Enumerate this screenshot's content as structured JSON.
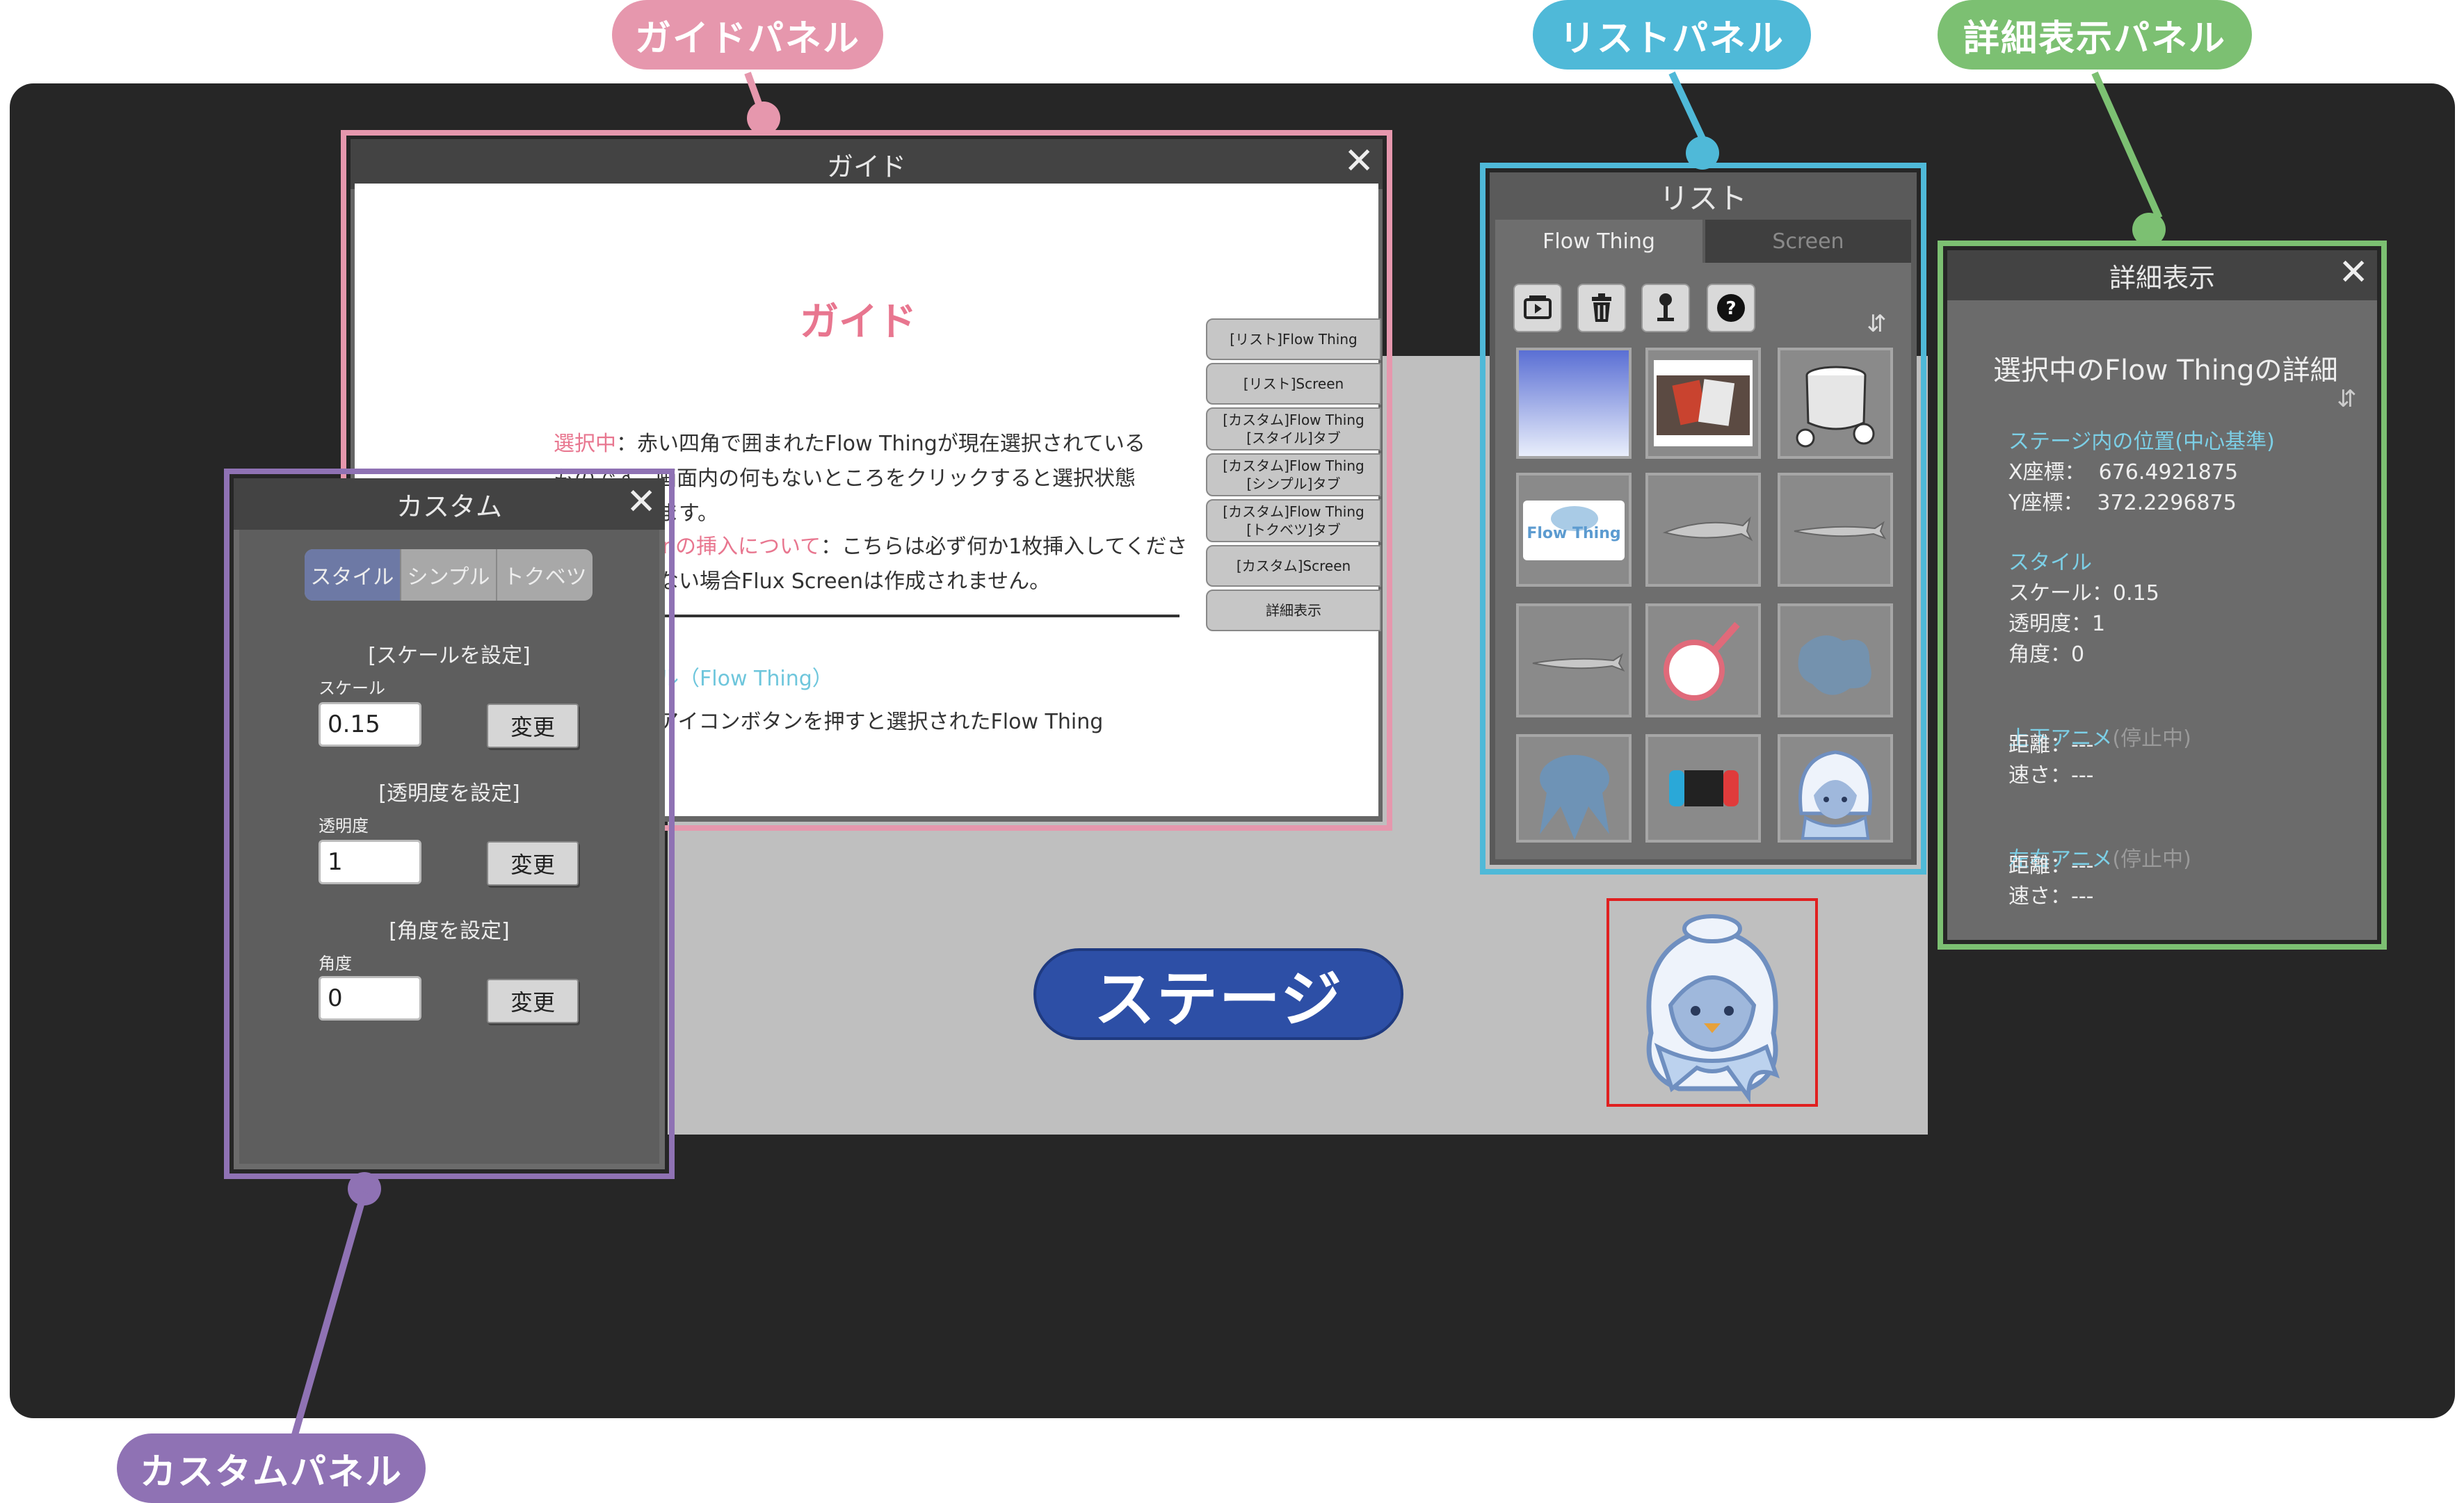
{
  "callouts": {
    "guide": "ガイドパネル",
    "list": "リストパネル",
    "detail": "詳細表示パネル",
    "custom": "カスタムパネル",
    "stage": "ステージ"
  },
  "colors": {
    "guide": "#e697ad",
    "list": "#4fb9d8",
    "detail": "#7cc072",
    "custom": "#8f72b4",
    "stage": "#2d4fa6",
    "selection": "#e02020"
  },
  "guide": {
    "title": "ガイド",
    "heading": "ガイド",
    "p1_em": "選択中",
    "p1_line1": "：赤い四角で囲まれたFlow Thingが現在選択されている",
    "p1_line2": "ものです。画面内の何もないところをクリックすると選択状態",
    "p1_line3": "を解除できます。",
    "p2_em": "Flux Screenの挿入について",
    "p2_line1": "：こちらは必ず何か1枚挿入してくださ",
    "p2_line2": "い。挿入がない場合Flux Screenは作成されません。",
    "sec_title": "リストパネル（Flow Thing）",
    "sec_line1": "パネル下のアイコンボタンを押すと選択されたFlow Thing",
    "tabs": [
      "[リスト]Flow Thing",
      "[リスト]Screen",
      "[カスタム]Flow Thing\n[スタイル]タブ",
      "[カスタム]Flow Thing\n[シンプル]タブ",
      "[カスタム]Flow Thing\n[トクベツ]タブ",
      "[カスタム]Screen",
      "詳細表示"
    ]
  },
  "custom": {
    "title": "カスタム",
    "tabs": [
      "スタイル",
      "シンプル",
      "トクベツ"
    ],
    "scale": {
      "heading": "[スケールを設定]",
      "label": "スケール",
      "value": "0.15",
      "button": "変更"
    },
    "opacity": {
      "heading": "[透明度を設定]",
      "label": "透明度",
      "value": "1",
      "button": "変更"
    },
    "angle": {
      "heading": "[角度を設定]",
      "label": "角度",
      "value": "0",
      "button": "変更"
    }
  },
  "list": {
    "title": "リスト",
    "tabs": [
      "Flow Thing",
      "Screen"
    ],
    "tools": [
      "screen-add-icon",
      "trash-icon",
      "pin-icon",
      "help-icon"
    ],
    "sort_icon": "⇵",
    "thumbs": [
      "gradient-screen",
      "photo-cards",
      "pot",
      "flow-thing-logo",
      "fish-1",
      "fish-2",
      "fish-3",
      "round-mirror",
      "blue-splash",
      "blue-creature",
      "game-console",
      "hooded-penguin"
    ],
    "logo_text": "Flow Thing"
  },
  "detail": {
    "title": "詳細表示",
    "heading": "選択中のFlow Thingの詳細",
    "sort_icon": "⇵",
    "pos_title": "ステージ内の位置(中心基準)",
    "x_line": "X座標：  676.4921875",
    "y_line": "Y座標：  372.2296875",
    "style_title": "スタイル",
    "scale_line": "スケール：0.15",
    "opacity_line": "透明度：1",
    "angle_line": "角度：0",
    "ud_title_a": "上下アニメ",
    "ud_title_b": "(停止中)",
    "ud_dist": "距離：---",
    "ud_speed": "速さ：---",
    "lr_title_a": "左右アニメ",
    "lr_title_b": "(停止中)",
    "lr_dist": "距離：---",
    "lr_speed": "速さ：---"
  }
}
